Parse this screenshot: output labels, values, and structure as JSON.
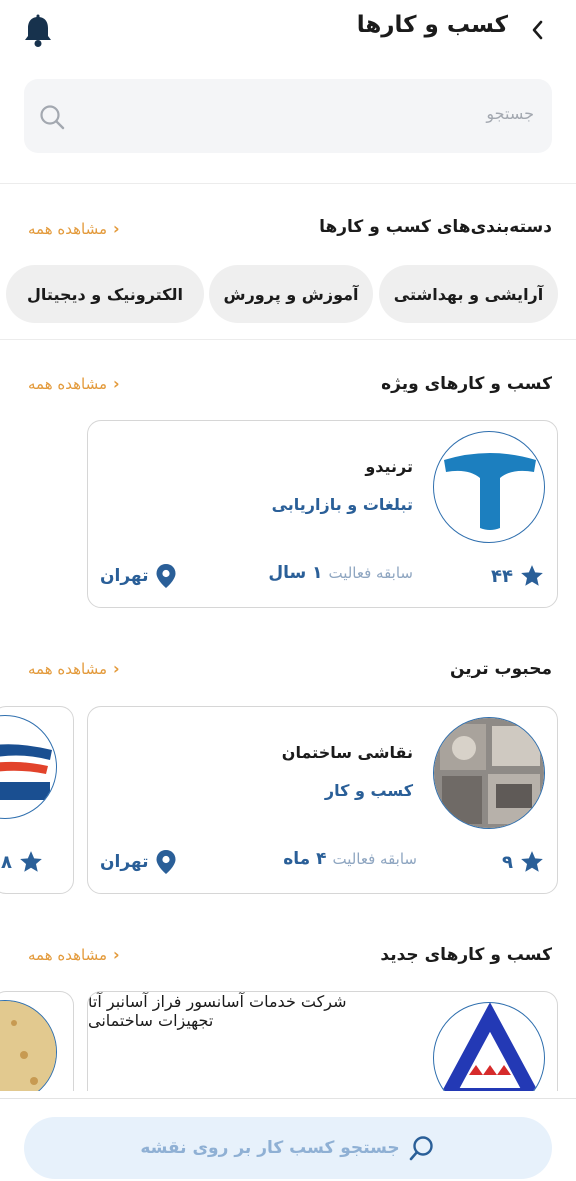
{
  "header": {
    "title": "کسب و کارها",
    "back_icon": "chevron-left-icon",
    "bell_icon": "bell-icon"
  },
  "search": {
    "placeholder": "جستجو",
    "icon": "search-icon"
  },
  "sections": {
    "categories": {
      "title": "دسته‌بندی‌های کسب و کارها",
      "see_all": "مشاهده همه",
      "chips": [
        "آرایشی و بهداشتی",
        "آموزش و پرورش",
        "الکترونیک و دیجیتال"
      ]
    },
    "featured": {
      "title": "کسب و کارهای ویژه",
      "see_all": "مشاهده همه",
      "card": {
        "name": "ترنیدو",
        "category": "تبلغات و بازاریابی",
        "rating": "۴۴",
        "experience_label": "سابقه فعالیت",
        "experience_value": "۱ سال",
        "city": "تهران"
      }
    },
    "popular": {
      "title": "محبوب ترین",
      "see_all": "مشاهده همه",
      "card": {
        "name": "نقاشی ساختمان",
        "category": "کسب و کار",
        "rating": "۹",
        "experience_label": "سابقه فعالیت",
        "experience_value": "۴ ماه",
        "city": "تهران"
      },
      "partial_card": {
        "rating": "۸"
      }
    },
    "newest": {
      "title": "کسب و کارهای جدید",
      "see_all": "مشاهده همه",
      "card": {
        "name": "شرکت خدمات آسانسور فراز آسانبر آتا",
        "category": "تجهیزات ساختمانی"
      }
    }
  },
  "bottom": {
    "map_search_label": "جستجو کسب کار بر روی نقشه",
    "icon": "search-icon"
  },
  "colors": {
    "accent_blue": "#2a5f98",
    "orange_link": "#e39a3b",
    "chip_bg": "#efefef"
  }
}
